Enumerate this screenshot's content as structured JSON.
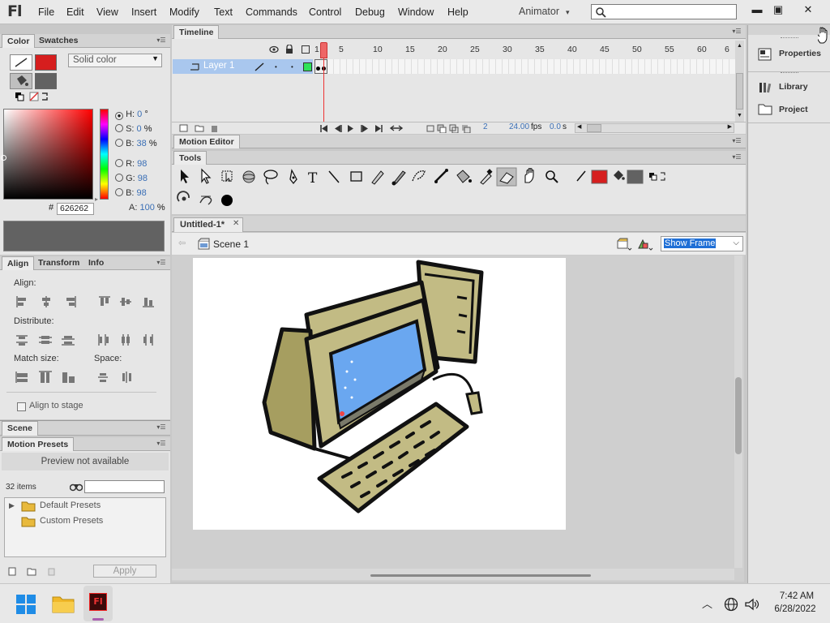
{
  "app": {
    "logo": "Fl"
  },
  "menu": [
    "File",
    "Edit",
    "View",
    "Insert",
    "Modify",
    "Text",
    "Commands",
    "Control",
    "Debug",
    "Window",
    "Help"
  ],
  "workspace": "Animator",
  "window_controls": {
    "min": "▬",
    "restore": "▣",
    "close": "✕"
  },
  "color_panel": {
    "tabs": [
      "Color",
      "Swatches"
    ],
    "fill_type": "Solid color",
    "stroke_color": "#d61e1e",
    "fill_color": "#626262",
    "hsb": [
      {
        "key": "H:",
        "val": "0",
        "unit": "°"
      },
      {
        "key": "S:",
        "val": "0",
        "unit": "%"
      },
      {
        "key": "B:",
        "val": "38",
        "unit": "%"
      }
    ],
    "rgb": [
      {
        "key": "R:",
        "val": "98"
      },
      {
        "key": "G:",
        "val": "98"
      },
      {
        "key": "B:",
        "val": "98"
      }
    ],
    "alpha": {
      "key": "A:",
      "val": "100",
      "unit": "%"
    },
    "hex_label": "#",
    "hex": "626262"
  },
  "align_panel": {
    "tabs": [
      "Align",
      "Transform",
      "Info"
    ],
    "align_label": "Align:",
    "distribute_label": "Distribute:",
    "match_label": "Match size:",
    "space_label": "Space:",
    "stage_checkbox": "Align to stage"
  },
  "scene_panel": {
    "title": "Scene"
  },
  "presets_panel": {
    "title": "Motion Presets",
    "preview": "Preview not available",
    "count": "32 items",
    "folders": [
      "Default Presets",
      "Custom Presets"
    ],
    "apply": "Apply"
  },
  "timeline": {
    "title": "Timeline",
    "layer": "Layer 1",
    "frame_numbers": [
      "1",
      "5",
      "10",
      "15",
      "20",
      "25",
      "30",
      "35",
      "40",
      "45",
      "50",
      "55",
      "60",
      "6"
    ],
    "current_frame": "2",
    "fps": "24.00",
    "fps_unit": "fps",
    "time": "0.0",
    "time_unit": "s"
  },
  "motion_editor": {
    "title": "Motion Editor"
  },
  "tools_panel": {
    "title": "Tools",
    "stroke_color": "#d61e1e",
    "fill_color": "#626262"
  },
  "document": {
    "tab": "Untitled-1*",
    "scene": "Scene 1",
    "zoom": "Show Frame"
  },
  "right_panel": {
    "items": [
      "Properties",
      "Library",
      "Project"
    ]
  },
  "taskbar": {
    "time": "7:42 AM",
    "date": "6/28/2022"
  }
}
